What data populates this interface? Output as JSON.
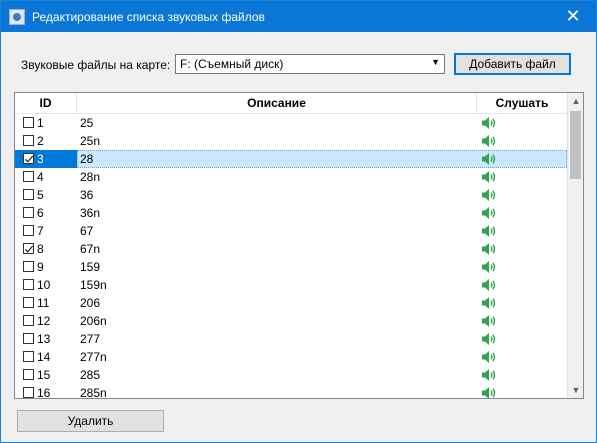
{
  "window": {
    "title": "Редактирование списка звуковых файлов",
    "close_glyph": "✕"
  },
  "toolbar": {
    "files_label": "Звуковые файлы на карте:",
    "drive_selected": "F: (Съемный диск)",
    "add_file_label": "Добавить файл"
  },
  "table": {
    "columns": {
      "id": "ID",
      "description": "Описание",
      "listen": "Слушать"
    },
    "rows": [
      {
        "id": "1",
        "desc": "25",
        "checked": false,
        "selected": false
      },
      {
        "id": "2",
        "desc": "25n",
        "checked": false,
        "selected": false
      },
      {
        "id": "3",
        "desc": "28",
        "checked": true,
        "selected": true
      },
      {
        "id": "4",
        "desc": "28n",
        "checked": false,
        "selected": false
      },
      {
        "id": "5",
        "desc": "36",
        "checked": false,
        "selected": false
      },
      {
        "id": "6",
        "desc": "36n",
        "checked": false,
        "selected": false
      },
      {
        "id": "7",
        "desc": "67",
        "checked": false,
        "selected": false
      },
      {
        "id": "8",
        "desc": "67n",
        "checked": true,
        "selected": false
      },
      {
        "id": "9",
        "desc": "159",
        "checked": false,
        "selected": false
      },
      {
        "id": "10",
        "desc": "159n",
        "checked": false,
        "selected": false
      },
      {
        "id": "11",
        "desc": "206",
        "checked": false,
        "selected": false
      },
      {
        "id": "12",
        "desc": "206n",
        "checked": false,
        "selected": false
      },
      {
        "id": "13",
        "desc": "277",
        "checked": false,
        "selected": false
      },
      {
        "id": "14",
        "desc": "277n",
        "checked": false,
        "selected": false
      },
      {
        "id": "15",
        "desc": "285",
        "checked": false,
        "selected": false
      },
      {
        "id": "16",
        "desc": "285n",
        "checked": false,
        "selected": false
      }
    ],
    "listen_icon": "speaker-icon"
  },
  "footer": {
    "delete_label": "Удалить"
  },
  "colors": {
    "titlebar": "#0a76d6",
    "selection": "#cce8ff",
    "speaker": "#2ea44f"
  }
}
